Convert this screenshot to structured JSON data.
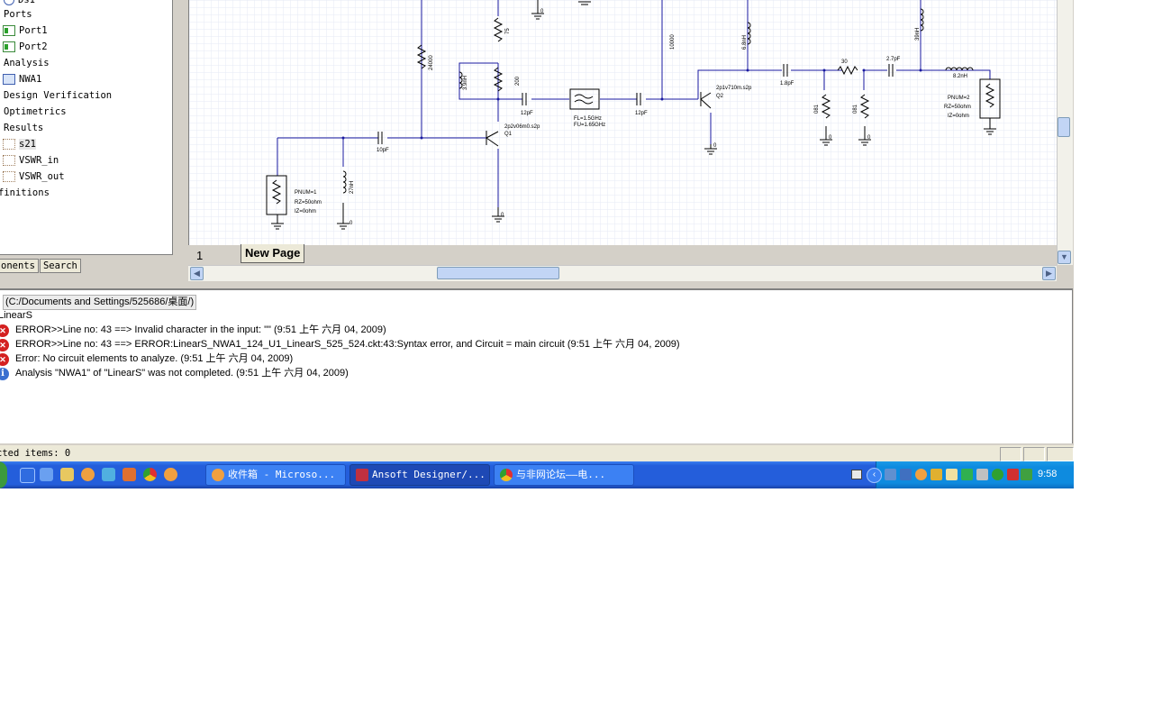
{
  "tree": {
    "items": [
      {
        "label": "Ports",
        "type": "folder"
      },
      {
        "label": "Port1",
        "type": "port"
      },
      {
        "label": "Port2",
        "type": "port"
      },
      {
        "label": "Analysis",
        "type": "folder"
      },
      {
        "label": "NWA1",
        "type": "analysis"
      },
      {
        "label": "Design Verification",
        "type": "folder"
      },
      {
        "label": "Optimetrics",
        "type": "folder"
      },
      {
        "label": "Results",
        "type": "folder"
      },
      {
        "label": "s21",
        "type": "result",
        "selected": true
      },
      {
        "label": "VSWR_in",
        "type": "result"
      },
      {
        "label": "VSWR_out",
        "type": "result"
      },
      {
        "label": "finitions",
        "type": "folder"
      }
    ],
    "tabs": [
      "onents",
      "Search"
    ]
  },
  "schematic": {
    "labels": {
      "r_24000": "24000",
      "r_75": "75",
      "r_200": "200",
      "l_3_9nh": "3.9nH",
      "r_10000": "10000",
      "l_6_8nh": "6.8nH",
      "l_39nh": "39nH",
      "l_8_2nh": "8.2nH",
      "c_12pf_a": "12pF",
      "c_12pf_b": "12pF",
      "c_10pf": "10pF",
      "c_1_8pf": "1.8pF",
      "c_2_7pf": "2.7pF",
      "r_30": "30",
      "r_081a": "081",
      "r_081b": "081",
      "l_27nh": "27nH",
      "q1_model": "2p2v06m0.s2p",
      "q1_name": "Q1",
      "q2_model": "2p1v710m.s2p",
      "q2_name": "Q2",
      "filter_fl": "FL=1.5GHz",
      "filter_fu": "FU=1.65GHz",
      "port1_pnum": "PNUM=1",
      "port1_rz": "RZ=50ohm",
      "port1_iz": "IZ=0ohm",
      "port2_pnum": "PNUM=2",
      "port2_rz": "RZ=50ohm",
      "port2_iz": "IZ=0ohm",
      "gnd": "0"
    },
    "page_number": "1",
    "page_tab": "New Page"
  },
  "messages": {
    "path_line": "(C:/Documents and Settings/525686/桌面/)",
    "design_line": "LinearS",
    "entries": [
      {
        "type": "error",
        "text": "ERROR>>Line no: 43 ==> Invalid character in the input: \"\"  (9:51 上午  六月 04, 2009)"
      },
      {
        "type": "error",
        "text": "ERROR>>Line no: 43 ==> ERROR:LinearS_NWA1_124_U1_LinearS_525_524.ckt:43:Syntax error, and   Circuit = main circuit   (9:51 上午  六月 04, 2009)"
      },
      {
        "type": "error",
        "text": "Error: No circuit elements to analyze. (9:51 上午  六月 04, 2009)"
      },
      {
        "type": "info",
        "text": "Analysis \"NWA1\" of \"LinearS\" was not completed. (9:51 上午  六月 04, 2009)"
      }
    ]
  },
  "status": {
    "text": "cted items: 0"
  },
  "taskbar": {
    "tasks": [
      {
        "label": "收件箱 - Microso...",
        "active": false
      },
      {
        "label": "Ansoft Designer/...",
        "active": true
      },
      {
        "label": "与非网论坛——电...",
        "active": false
      }
    ],
    "clock": "9:58"
  },
  "colors": {
    "wire": "#1a1aa0",
    "accent": "#245edb",
    "grid": "#e6eaf4"
  }
}
